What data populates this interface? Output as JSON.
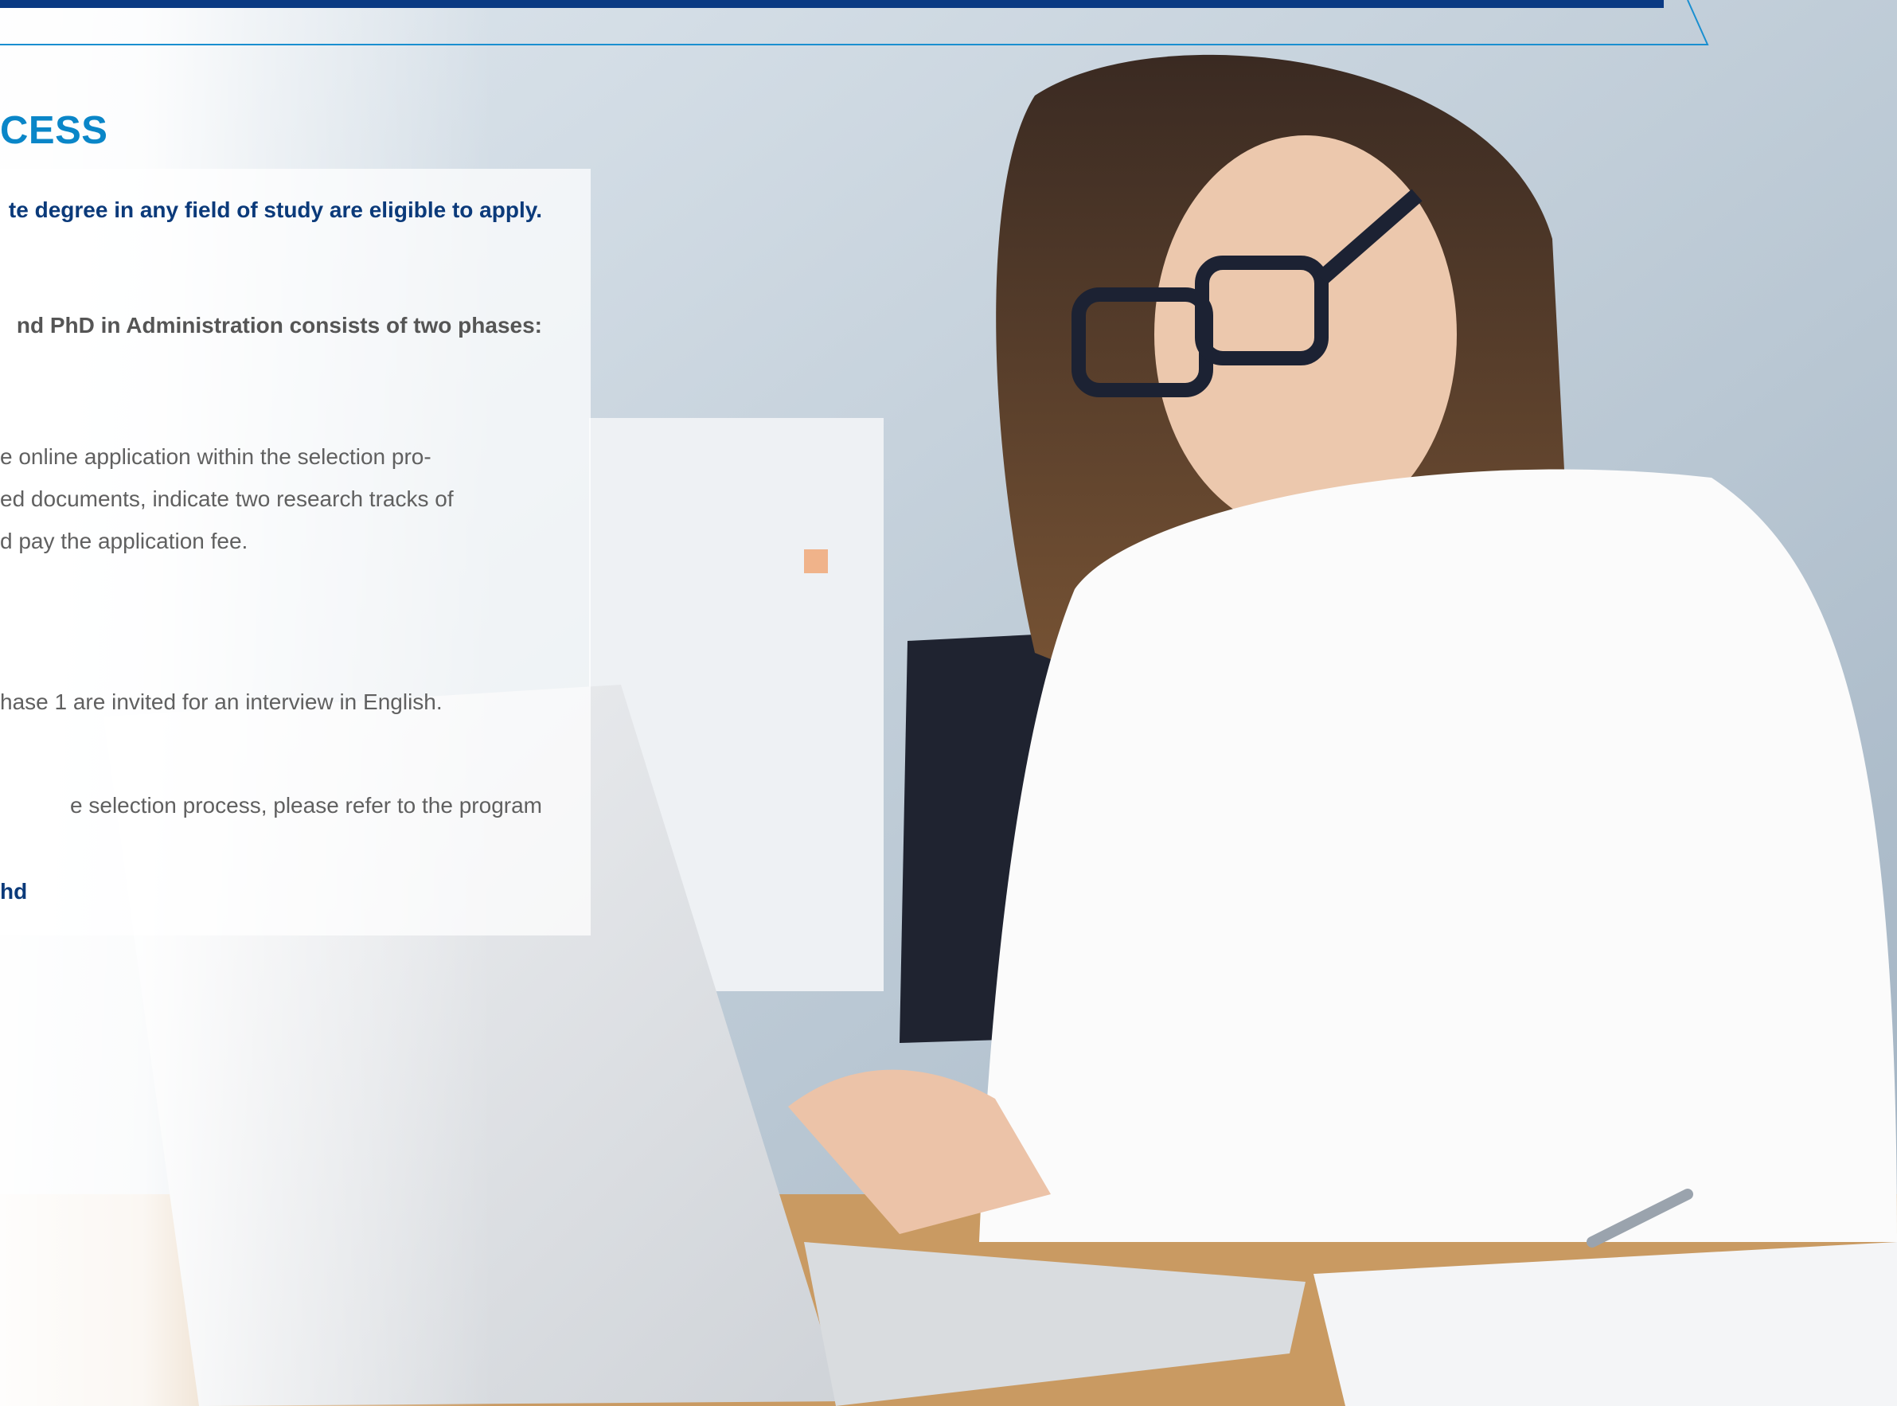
{
  "header": {
    "section_title": "CESS"
  },
  "content": {
    "eligibility_line": "te degree in any field of study are eligible to apply.",
    "phases_intro": "nd PhD in Administration consists of two phases:",
    "phase1_lines": [
      "e online application within the selection pro-",
      "ed documents, indicate two research tracks of",
      "d pay the application fee."
    ],
    "phase2_line": "hase 1 are invited for an interview in English.",
    "more_info_line": "e selection process, please refer to the program",
    "link_fragment": "hd"
  },
  "colors": {
    "brand_navy": "#0a3a83",
    "heading_blue": "#0a86c8",
    "bold_navy_text": "#0b3a7a",
    "body_gray": "#606060"
  }
}
